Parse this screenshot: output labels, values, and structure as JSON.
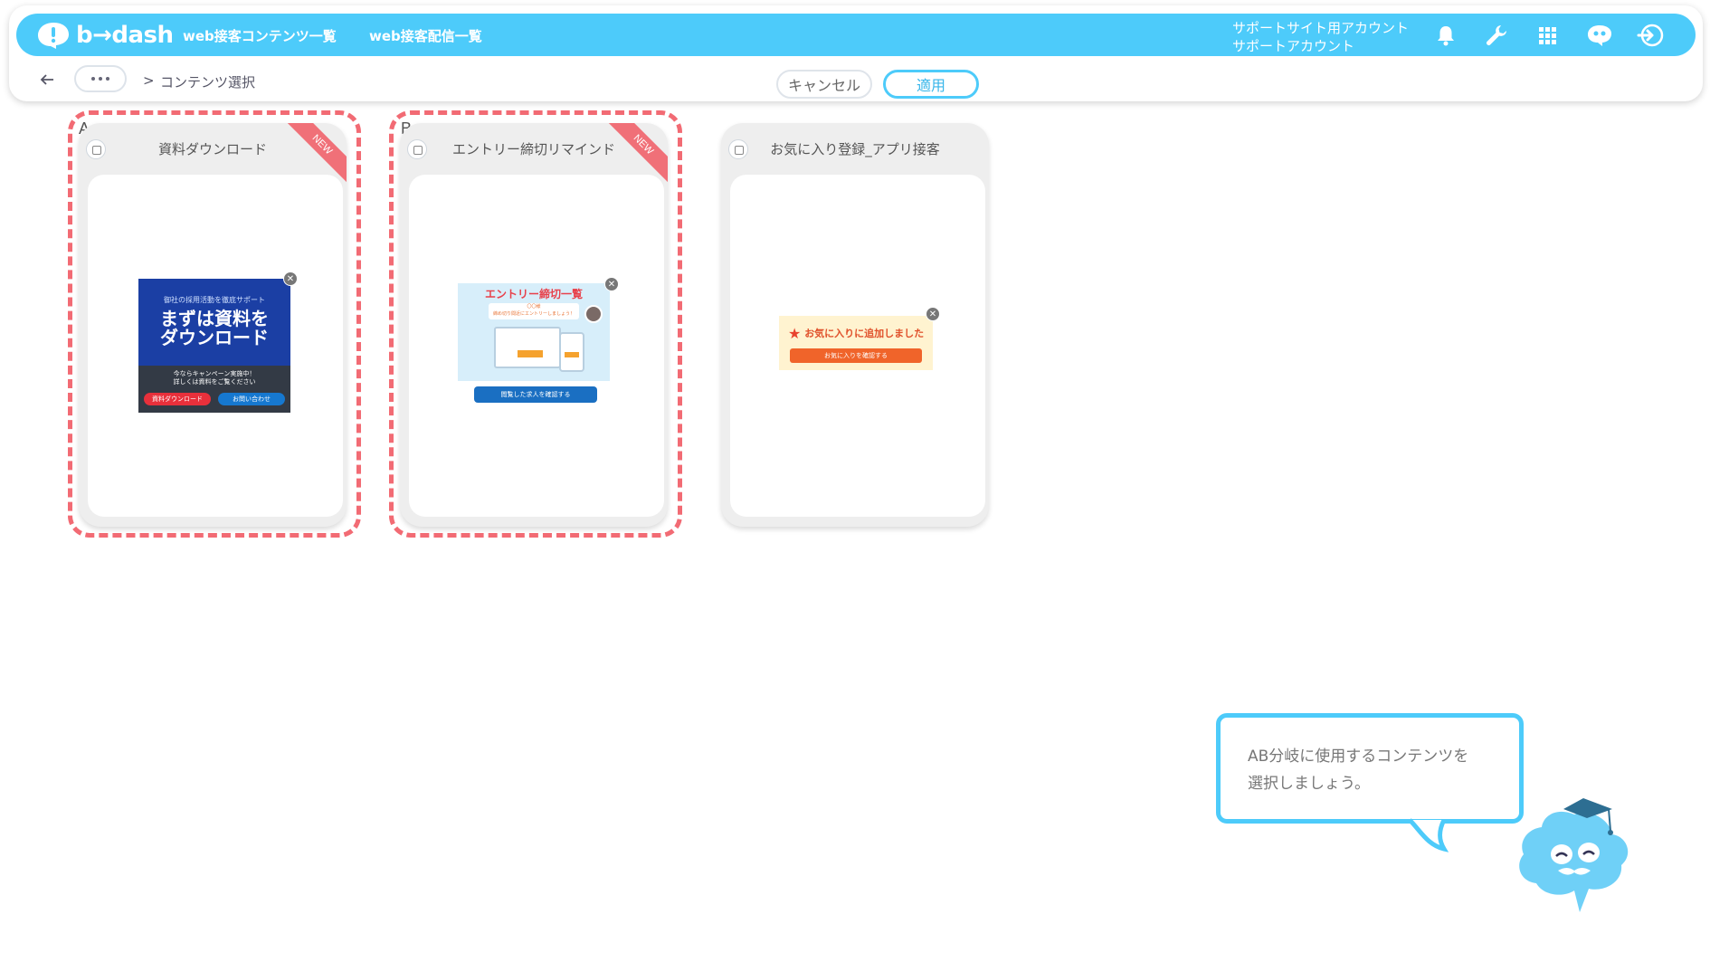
{
  "header": {
    "logo_text": "b→dash",
    "nav_links": [
      "web接客コンテンツ一覧",
      "web接客配信一覧"
    ],
    "account_line1": "サポートサイト用アカウント",
    "account_line2": "サポートアカウント",
    "icons": [
      "bell-icon",
      "wrench-icon",
      "grid-icon",
      "mascot-chat-icon",
      "logout-icon"
    ]
  },
  "subbar": {
    "breadcrumb_sep": ">",
    "breadcrumb_current": "コンテンツ選択",
    "cancel_label": "キャンセル",
    "apply_label": "適用"
  },
  "cards": [
    {
      "ab": "A",
      "title": "資料ダウンロード",
      "badge": "NEW",
      "banner": {
        "sub": "御社の採用活動を徹底サポート",
        "main_line1": "まずは資料を",
        "main_line2": "ダウンロード",
        "note_line1": "今ならキャンペーン実施中！",
        "note_line2": "詳しくは資料をご覧ください",
        "btn1": "資料ダウンロード",
        "btn2": "お問い合わせ"
      }
    },
    {
      "ab": "B",
      "title": "エントリー締切リマインド",
      "badge": "NEW",
      "banner": {
        "title": "エントリー締切一覧",
        "bubble_line1": "〇〇様",
        "bubble_line2": "締め切り間近にエントリーしましょう！",
        "button": "閲覧した求人を確認する"
      }
    },
    {
      "ab": "",
      "title": "お気に入り登録_アプリ接客",
      "badge": "",
      "banner": {
        "title": "お気に入りに追加しました",
        "button": "お気に入りを確認する"
      }
    }
  ],
  "guide": {
    "line1": "AB分岐に使用するコンテンツを",
    "line2": "選択しましょう。"
  },
  "colors": {
    "accent": "#4dcbfa",
    "highlight": "#f26b74"
  }
}
